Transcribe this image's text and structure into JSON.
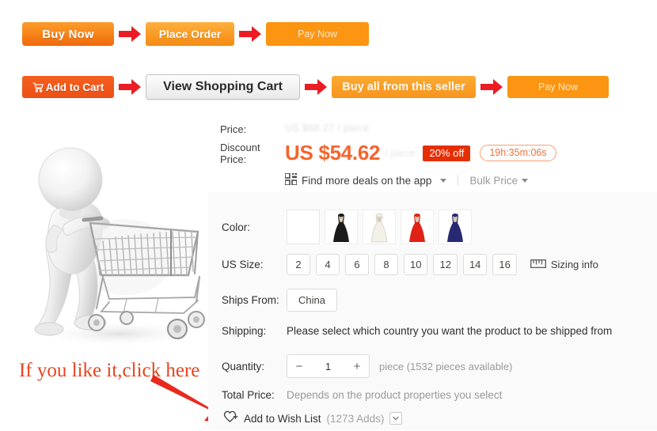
{
  "flow": {
    "row1": [
      {
        "label": "Buy Now",
        "name": "buy-now-button"
      },
      {
        "label": "Place Order",
        "name": "place-order-button"
      },
      {
        "label": "Pay Now",
        "name": "pay-now-button-1"
      }
    ],
    "row2": [
      {
        "label": "Add to Cart",
        "name": "add-to-cart-button"
      },
      {
        "label": "View Shopping Cart",
        "name": "view-shopping-cart-button"
      },
      {
        "label": "Buy all from this seller",
        "name": "buy-all-from-seller-button"
      },
      {
        "label": "Pay Now",
        "name": "pay-now-button-2"
      }
    ]
  },
  "annotation": {
    "text": "If you like it,click here",
    "color": "#e8441f"
  },
  "price": {
    "price_label": "Price:",
    "original_price": "US $68.27 / piece",
    "discount_label_line1": "Discount",
    "discount_label_line2": "Price:",
    "discount_price": "US $54.62",
    "discount_unit": "/ piece",
    "discount_badge": "20% off",
    "countdown": "19h:35m:06s",
    "app_deals": "Find more deals on the app",
    "bulk_price": "Bulk Price",
    "badge_color": "#e62e04",
    "price_color": "#f7642d"
  },
  "options": {
    "color": {
      "label": "Color:",
      "swatches": [
        {
          "name": "swatch-blank",
          "color": "#ffffff"
        },
        {
          "name": "swatch-black",
          "color": "#1b1b1b"
        },
        {
          "name": "swatch-white",
          "color": "#f0ece3"
        },
        {
          "name": "swatch-red",
          "color": "#e02214"
        },
        {
          "name": "swatch-navy",
          "color": "#272a72"
        }
      ]
    },
    "size": {
      "label": "US Size:",
      "values": [
        "2",
        "4",
        "6",
        "8",
        "10",
        "12",
        "14",
        "16"
      ],
      "sizing_info": "Sizing info"
    },
    "ships_from": {
      "label": "Ships From:",
      "value": "China"
    },
    "shipping": {
      "label": "Shipping:",
      "text": "Please select which country you want the product to be shipped from"
    },
    "quantity": {
      "label": "Quantity:",
      "value": "1",
      "minus": "−",
      "plus": "+",
      "note": "piece (1532 pieces available)"
    },
    "total": {
      "label": "Total Price:",
      "text": "Depends on the product properties you select"
    }
  },
  "wishlist": {
    "label": "Add to Wish List",
    "count": "(1273 Adds)"
  }
}
